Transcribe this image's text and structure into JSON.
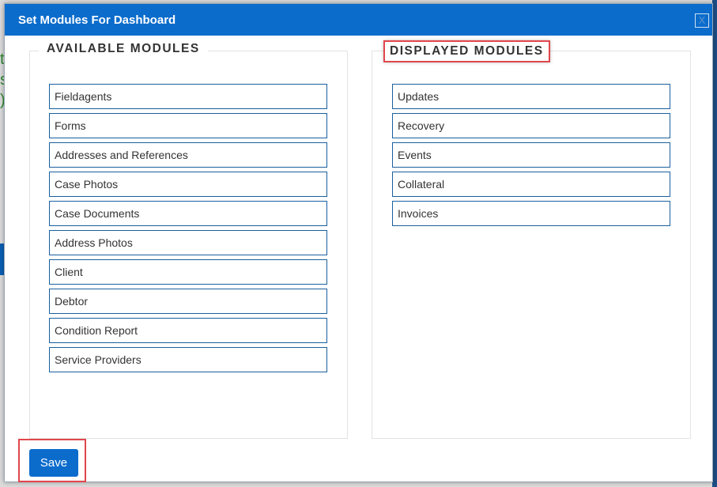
{
  "dialog": {
    "title": "Set Modules For Dashboard",
    "close_label": "X"
  },
  "available": {
    "heading": "AVAILABLE MODULES",
    "items": [
      "Fieldagents",
      "Forms",
      "Addresses and References",
      "Case Photos",
      "Case Documents",
      "Address Photos",
      "Client",
      "Debtor",
      "Condition Report",
      "Service Providers"
    ]
  },
  "displayed": {
    "heading": "DISPLAYED MODULES",
    "items": [
      "Updates",
      "Recovery",
      "Events",
      "Collateral",
      "Invoices"
    ]
  },
  "footer": {
    "save_label": "Save"
  },
  "colors": {
    "accent": "#0b6ccc",
    "highlight": "#e0474c",
    "item_border": "#1a5f9e"
  }
}
